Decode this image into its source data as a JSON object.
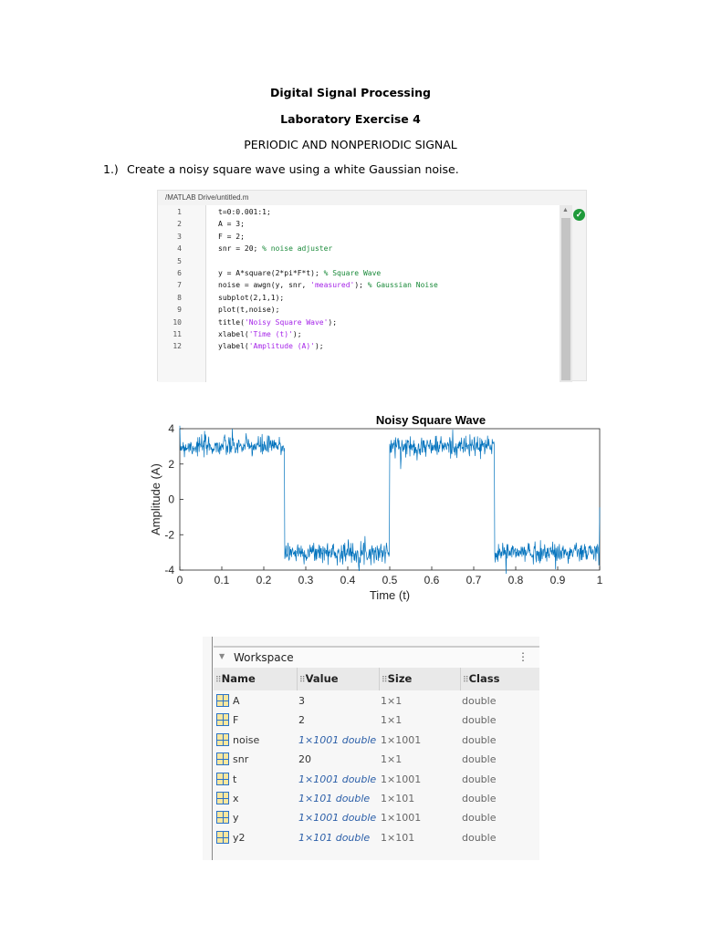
{
  "document": {
    "title": "Digital Signal Processing",
    "subtitle": "Laboratory Exercise 4",
    "topic": "PERIODIC AND NONPERIODIC SIGNAL",
    "item_number": "1.)",
    "item_text": "Create a noisy square wave using a white Gaussian noise."
  },
  "editor": {
    "path": "/MATLAB Drive/untitled.m",
    "status_icon": "check-circle-icon",
    "lines": [
      [
        [
          "t=0:0.001:1;",
          "code"
        ]
      ],
      [
        [
          "A = 3;",
          "code"
        ]
      ],
      [
        [
          "F = 2;",
          "code"
        ]
      ],
      [
        [
          "snr = 20; ",
          "code"
        ],
        [
          "% noise adjuster",
          "comment"
        ]
      ],
      [],
      [
        [
          "y = A*square(2*pi*F*t); ",
          "code"
        ],
        [
          "% Square Wave",
          "comment"
        ]
      ],
      [
        [
          "noise = awgn(y, snr, ",
          "code"
        ],
        [
          "'measured'",
          "string"
        ],
        [
          "); ",
          "code"
        ],
        [
          "% Gaussian Noise",
          "comment"
        ]
      ],
      [
        [
          "subplot(2,1,1);",
          "code"
        ]
      ],
      [
        [
          "plot(t,noise);",
          "code"
        ]
      ],
      [
        [
          "title(",
          "code"
        ],
        [
          "'Noisy Square Wave'",
          "string"
        ],
        [
          ");",
          "code"
        ]
      ],
      [
        [
          "xlabel(",
          "code"
        ],
        [
          "'Time (t)'",
          "string"
        ],
        [
          ");",
          "code"
        ]
      ],
      [
        [
          "ylabel(",
          "code"
        ],
        [
          "'Amplitude (A)'",
          "string"
        ],
        [
          ");",
          "code"
        ]
      ]
    ]
  },
  "chart_data": {
    "type": "line",
    "title": "Noisy Square Wave",
    "xlabel": "Time (t)",
    "ylabel": "Amplitude (A)",
    "xlim": [
      0,
      1
    ],
    "ylim": [
      -4,
      4
    ],
    "xticks": [
      "0",
      "0.1",
      "0.2",
      "0.3",
      "0.4",
      "0.5",
      "0.6",
      "0.7",
      "0.8",
      "0.9",
      "1"
    ],
    "yticks": [
      "4",
      "2",
      "0",
      "-2",
      "-4"
    ],
    "series": [
      {
        "name": "noise",
        "color": "#0072bd",
        "amplitude": 3,
        "frequency": 2,
        "t_step": 0.001,
        "noise_std": 0.3,
        "segments": [
          {
            "t": [
              0,
              0.25
            ],
            "level": 3
          },
          {
            "t": [
              0.25,
              0.5
            ],
            "level": -3
          },
          {
            "t": [
              0.5,
              0.75
            ],
            "level": 3
          },
          {
            "t": [
              0.75,
              1
            ],
            "level": -3
          }
        ]
      }
    ]
  },
  "workspace": {
    "title": "Workspace",
    "columns": [
      "Name",
      "Value",
      "Size",
      "Class"
    ],
    "rows": [
      {
        "name": "A",
        "value": "3",
        "size": "1×1",
        "class": "double",
        "italic": false
      },
      {
        "name": "F",
        "value": "2",
        "size": "1×1",
        "class": "double",
        "italic": false
      },
      {
        "name": "noise",
        "value": "1×1001 double",
        "size": "1×1001",
        "class": "double",
        "italic": true
      },
      {
        "name": "snr",
        "value": "20",
        "size": "1×1",
        "class": "double",
        "italic": false
      },
      {
        "name": "t",
        "value": "1×1001 double",
        "size": "1×1001",
        "class": "double",
        "italic": true
      },
      {
        "name": "x",
        "value": "1×101 double",
        "size": "1×101",
        "class": "double",
        "italic": true
      },
      {
        "name": "y",
        "value": "1×1001 double",
        "size": "1×1001",
        "class": "double",
        "italic": true
      },
      {
        "name": "y2",
        "value": "1×101 double",
        "size": "1×101",
        "class": "double",
        "italic": true
      }
    ]
  }
}
